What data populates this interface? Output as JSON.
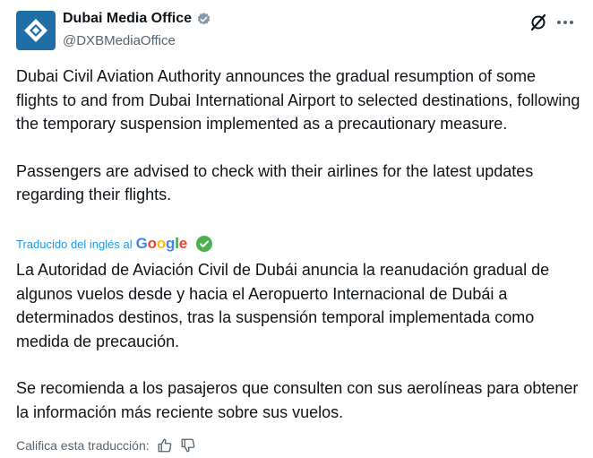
{
  "author": {
    "display_name": "Dubai Media Office",
    "handle": "@DXBMediaOffice",
    "verified": true,
    "avatar_icon": "dubai-media-office-logo",
    "avatar_color": "#1f6fa6"
  },
  "header_actions": {
    "grok_icon": "grok-icon",
    "more_icon": "more-icon"
  },
  "tweet": {
    "paragraph_1": "Dubai Civil Aviation Authority announces the gradual resumption of some flights to and from Dubai International Airport to selected destinations, following the temporary suspension implemented as a precautionary measure.",
    "paragraph_2": "Passengers are advised to check with their airlines for the latest updates regarding their flights."
  },
  "translation": {
    "label": "Traducido del inglés al",
    "provider": "Google",
    "link_color": "#1d9bf0",
    "check_color": "#4caf50",
    "paragraph_1": "La Autoridad de Aviación Civil de Dubái anuncia la reanudación gradual de algunos vuelos desde y hacia el Aeropuerto Internacional de Dubái a determinados destinos, tras la suspensión temporal implementada como medida de precaución.",
    "paragraph_2": "Se recomienda a los pasajeros que consulten con sus aerolíneas para obtener la información más reciente sobre sus vuelos.",
    "rate_label": "Califica esta traducción:",
    "thumbs_up_icon": "thumbs-up-icon",
    "thumbs_down_icon": "thumbs-down-icon"
  }
}
